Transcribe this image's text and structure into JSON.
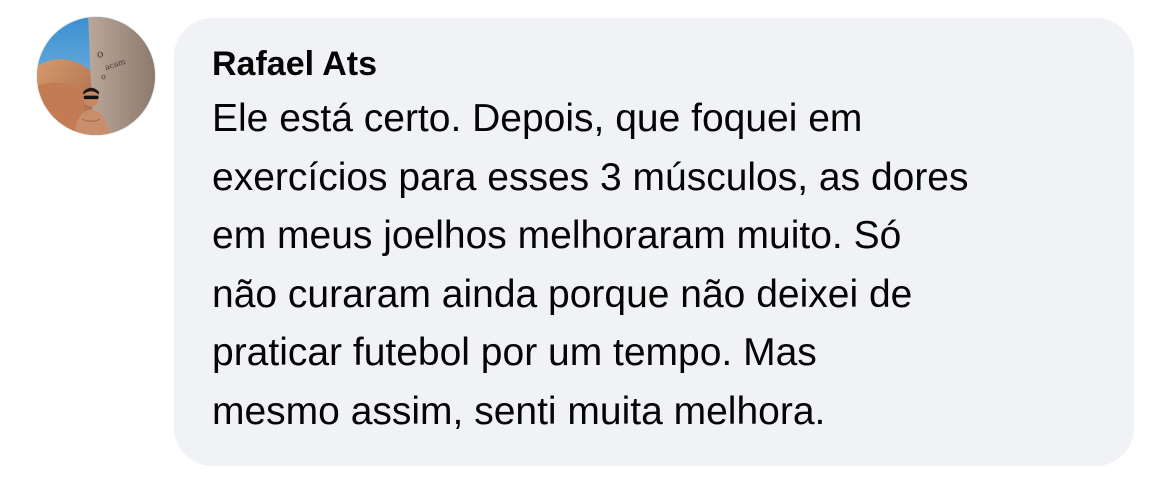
{
  "comment": {
    "author": "Rafael Ats",
    "text_lines": [
      "Ele está certo. Depois, que foquei em",
      "exercícios para esses 3 músculos, as dores",
      "em meus joelhos melhoraram muito. Só",
      "não curaram ainda porque não deixei de",
      "praticar futebol por um tempo. Mas",
      "mesmo assim, senti muita melhora."
    ]
  },
  "colors": {
    "bubble_background": "#f0f2f5",
    "text": "#050505",
    "page_background": "#ffffff"
  }
}
